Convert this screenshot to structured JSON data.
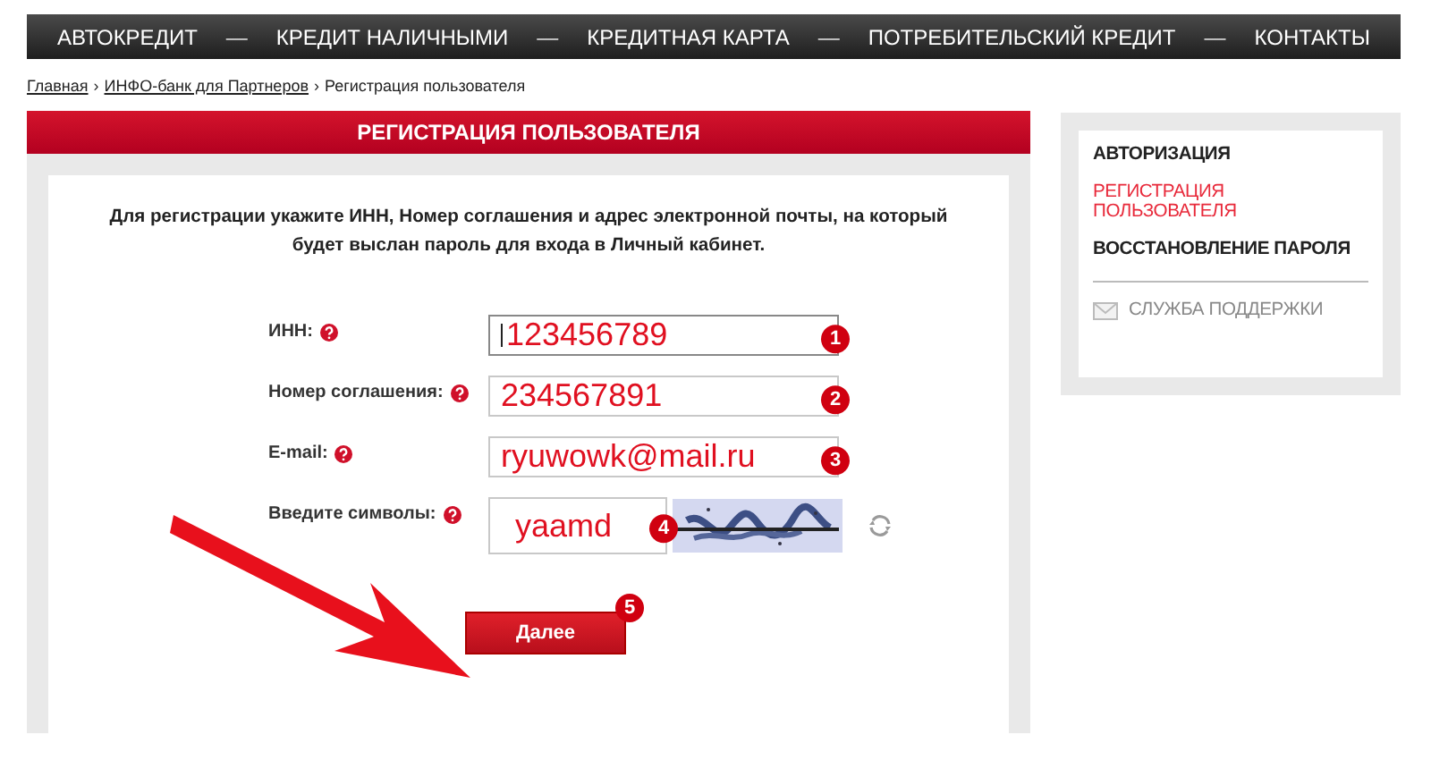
{
  "nav": [
    {
      "label": "АВТОКРЕДИТ"
    },
    {
      "label": "КРЕДИТ НАЛИЧНЫМИ"
    },
    {
      "label": "КРЕДИТНАЯ КАРТА"
    },
    {
      "label": "ПОТРЕБИТЕЛЬСКИЙ КРЕДИТ"
    },
    {
      "label": "КОНТАКТЫ"
    }
  ],
  "nav_separator": "—",
  "breadcrumb": {
    "links": [
      "Главная",
      "ИНФО-банк для Партнеров"
    ],
    "separator": "›",
    "current": "Регистрация пользователя"
  },
  "panel": {
    "title": "РЕГИСТРАЦИЯ ПОЛЬЗОВАТЕЛЯ",
    "intro": "Для регистрации укажите ИНН, Номер соглашения и адрес электронной почты, на который будет выслан пароль для входа в Личный кабинет.",
    "fields": [
      {
        "kind": "text",
        "label": "ИНН:",
        "value": "123456789",
        "marker": "1",
        "focused": true
      },
      {
        "kind": "text",
        "label": "Номер соглашения:",
        "value": "234567891",
        "marker": "2",
        "focused": false
      },
      {
        "kind": "text",
        "label": "E-mail:",
        "value": "ryuwowk@mail.ru",
        "marker": "3",
        "focused": false
      },
      {
        "kind": "captcha",
        "label": "Введите символы:",
        "value": "yaamd",
        "marker": "4",
        "focused": false
      }
    ],
    "button": {
      "label": "Далее",
      "marker": "5"
    }
  },
  "sidebar": {
    "items": [
      {
        "label": "АВТОРИЗАЦИЯ",
        "selected": false
      },
      {
        "label": "РЕГИСТРАЦИЯ ПОЛЬЗОВАТЕЛЯ",
        "selected": true
      },
      {
        "label": "ВОССТАНОВЛЕНИЕ ПАРОЛЯ",
        "selected": false
      }
    ],
    "support": "СЛУЖБА ПОДДЕРЖКИ"
  }
}
